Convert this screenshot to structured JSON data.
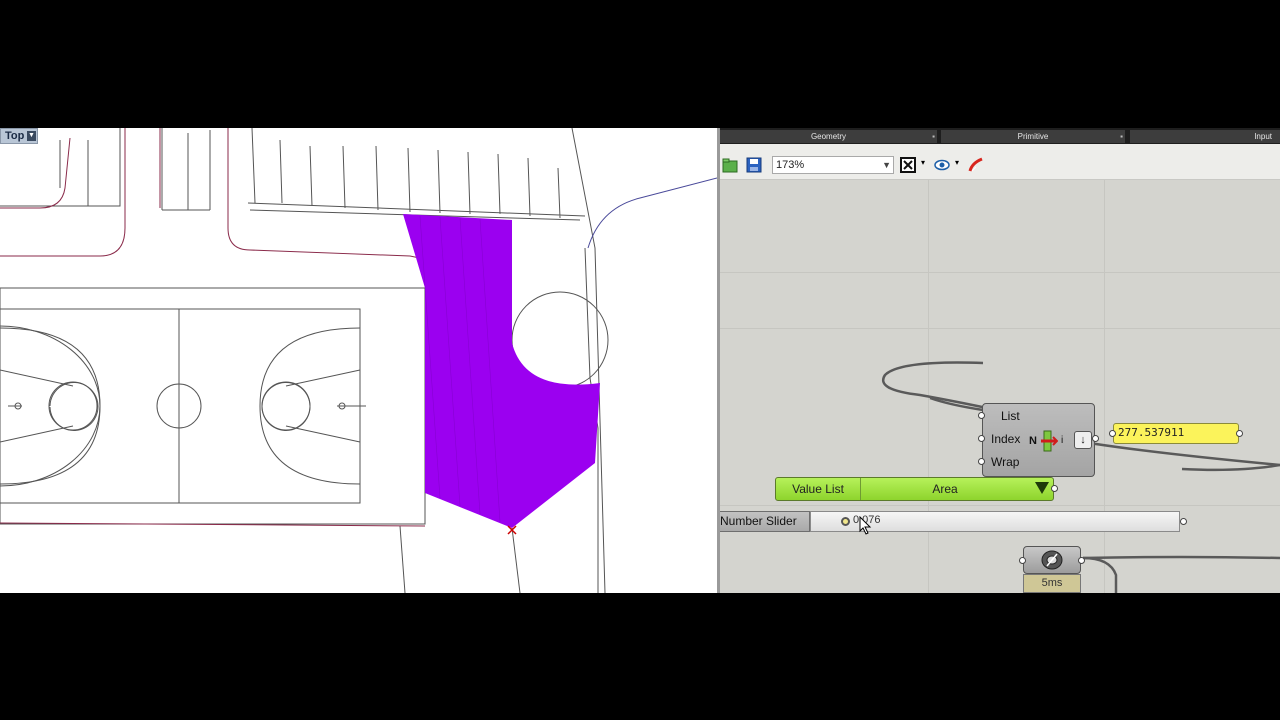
{
  "viewport": {
    "label": "Top",
    "fill_color": "#9b00f0"
  },
  "grasshopper": {
    "tabs": [
      {
        "label": "Geometry"
      },
      {
        "label": "Primitive"
      },
      {
        "label": "Input"
      }
    ],
    "toolbar": {
      "zoom": "173%",
      "icons": [
        "open-icon",
        "save-icon",
        "zoom-extents-icon",
        "preview-eye-icon",
        "sketch-pen-icon"
      ]
    },
    "list_item": {
      "inputs": [
        "List",
        "Index",
        "Wrap"
      ],
      "index_flag": "N",
      "index_i": "i"
    },
    "panel": {
      "value": "277.537911"
    },
    "value_list": {
      "label": "Value List",
      "selected": "Area"
    },
    "number_slider": {
      "label": "Number Slider",
      "value": "0.076"
    },
    "timer": {
      "label": "5ms"
    }
  }
}
